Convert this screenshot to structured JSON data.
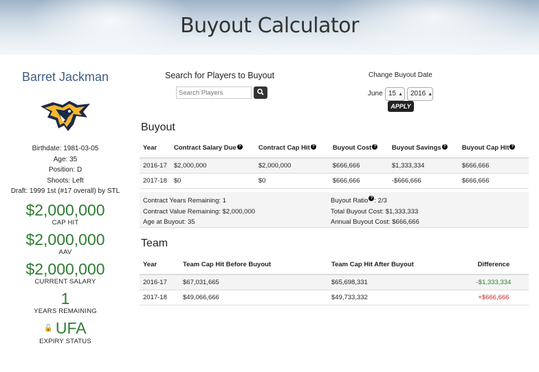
{
  "header": {
    "title": "Buyout Calculator"
  },
  "player": {
    "name": "Barret Jackman",
    "logo_icon": "predators-logo",
    "birthdate": "Birthdate: 1981-03-05",
    "age": "Age: 35",
    "position": "Position: D",
    "shoots": "Shoots: Left",
    "draft": "Draft: 1999 1st (#17 overall) by STL",
    "stats": [
      {
        "value": "$2,000,000",
        "label": "CAP HIT"
      },
      {
        "value": "$2,000,000",
        "label": "AAV"
      },
      {
        "value": "$2,000,000",
        "label": "CURRENT SALARY"
      },
      {
        "value": "1",
        "label": "YEARS REMAINING"
      },
      {
        "value": "UFA",
        "label": "EXPIRY STATUS"
      }
    ]
  },
  "search": {
    "title": "Search for Players to Buyout",
    "placeholder": "Search Players",
    "button_icon": "search-icon"
  },
  "buyout_date": {
    "title": "Change Buyout Date",
    "month": "June",
    "day": "15",
    "year": "2016",
    "apply_label": "APPLY"
  },
  "buyout": {
    "heading": "Buyout",
    "columns": [
      "Year",
      "Contract Salary Due",
      "Contract Cap Hit",
      "Buyout Cost",
      "Buyout Savings",
      "Buyout Cap Hit"
    ],
    "rows": [
      [
        "2016-17",
        "$2,000,000",
        "$2,000,000",
        "$666,666",
        "$1,333,334",
        "$666,666"
      ],
      [
        "2017-18",
        "$0",
        "$0",
        "$666,666",
        "-$666,666",
        "$666,666"
      ]
    ],
    "summary": {
      "years_remaining": "Contract Years Remaining: 1",
      "value_remaining": "Contract Value Remaining: $2,000,000",
      "age_at_buyout": "Age at Buyout: 35",
      "ratio_label": "Buyout Ratio",
      "ratio_value": ": 2/3",
      "total_cost": "Total Buyout Cost: $1,333,333",
      "annual_cost": "Annual Buyout Cost: $666,666"
    }
  },
  "team": {
    "heading": "Team",
    "columns": [
      "Year",
      "Team Cap Hit Before Buyout",
      "Team Cap Hit After Buyout",
      "Difference"
    ],
    "rows": [
      [
        "2016-17",
        "$67,031,665",
        "$65,698,331",
        "-$1,333,334"
      ],
      [
        "2017-18",
        "$49,066,666",
        "$49,733,332",
        "+$666,666"
      ]
    ]
  },
  "colors": {
    "accent_green": "#2e7d32",
    "negative_red": "#c62828",
    "name_blue": "#3d5f82"
  }
}
